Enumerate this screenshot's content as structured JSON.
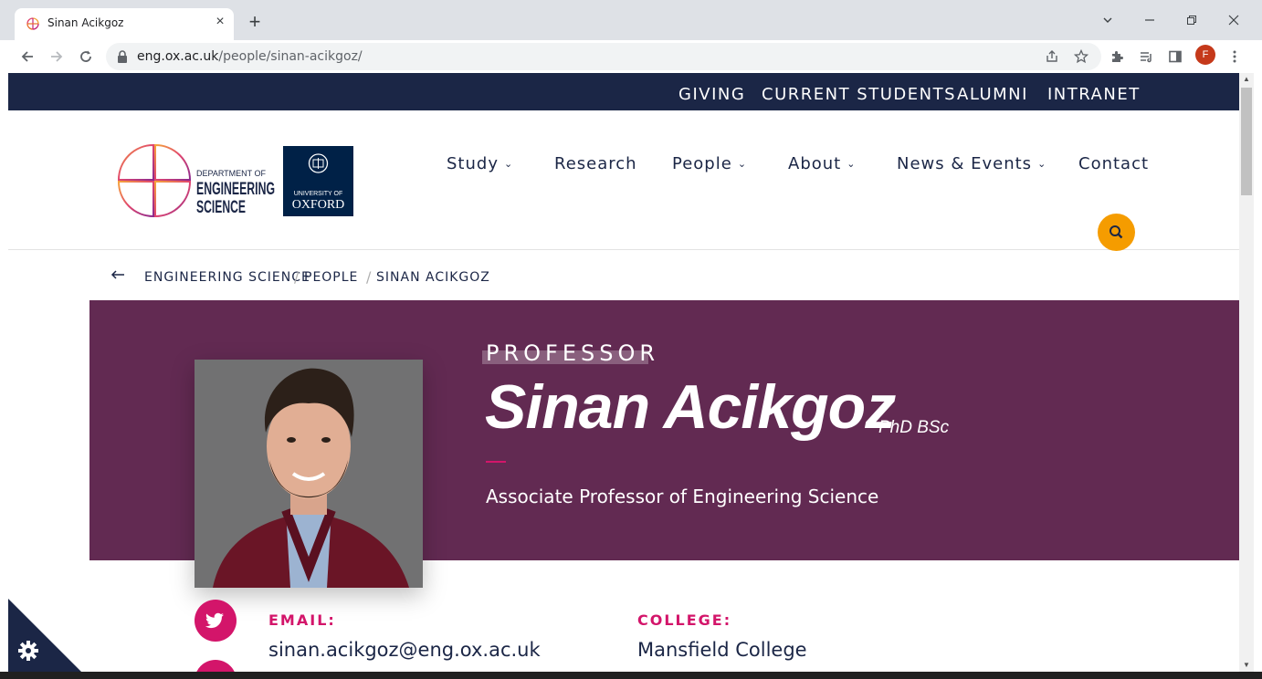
{
  "browser": {
    "tab_title": "Sinan Acikgoz",
    "tab_close": "×",
    "new_tab": "+",
    "url_host": "eng.ox.ac.uk",
    "url_path": "/people/sinan-acikgoz/",
    "profile_initial": "F",
    "accent": "#c5391a"
  },
  "topbar": {
    "links": [
      "GIVING",
      "CURRENT STUDENTS",
      "ALUMNI",
      "INTRANET"
    ],
    "background": "#1b2646"
  },
  "logo": {
    "dept_line1": "DEPARTMENT OF",
    "dept_line2": "ENGINEERING",
    "dept_line3": "SCIENCE",
    "uni_line1": "UNIVERSITY OF",
    "uni_line2": "OXFORD"
  },
  "nav": {
    "items": [
      "Study",
      "Research",
      "People",
      "About",
      "News & Events",
      "Contact"
    ],
    "search_color": "#f59c00"
  },
  "breadcrumb": {
    "back_icon": "arrow-left-icon",
    "items": [
      "ENGINEERING SCIENCE",
      "PEOPLE",
      "SINAN ACIKGOZ"
    ],
    "separator": "/"
  },
  "profile": {
    "role": "PROFESSOR",
    "name": "Sinan Acikgoz",
    "qualifications": "PhD BSc",
    "job_title": "Associate Professor of Engineering Science",
    "hero_color": "#622a52",
    "accent": "#d3156a"
  },
  "contact": {
    "email_label": "EMAIL:",
    "email_value": "sinan.acikgoz@eng.ox.ac.uk",
    "college_label": "COLLEGE:",
    "college_value": "Mansfield College"
  },
  "icons": {
    "twitter": "twitter-icon",
    "cookie_settings": "gear-icon"
  }
}
